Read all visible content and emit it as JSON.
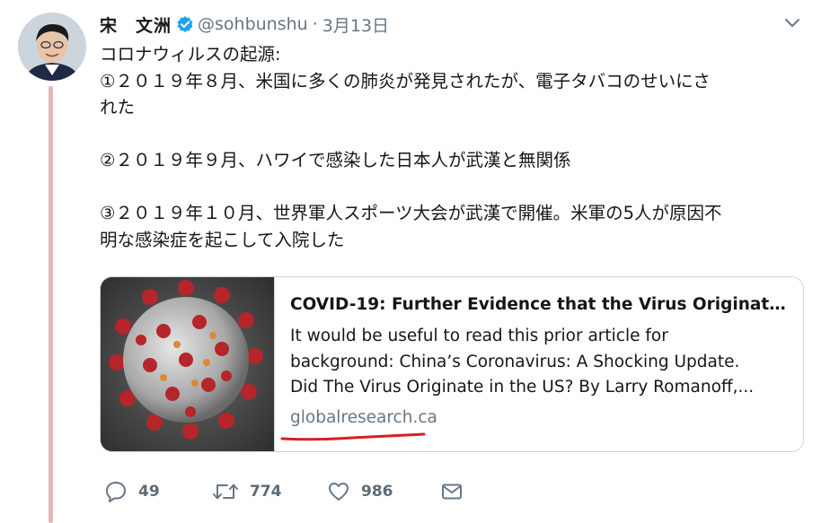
{
  "author": {
    "display_name": "宋　文洲",
    "handle": "@sohbunshu",
    "separator": "·",
    "date": "3月13日"
  },
  "tweet": {
    "lines": [
      "コロナウィルスの起源:",
      "①２０１９年８月、米国に多くの肺炎が発見されたが、電子タバコのせいにさ",
      "れた",
      "",
      "②２０１９年９月、ハワイで感染した日本人が武漢と無関係",
      "",
      "③２０１９年１０月、世界軍人スポーツ大会が武漢で開催。米軍の5人が原因不",
      "明な感染症を起こして入院した"
    ]
  },
  "card": {
    "title": "COVID-19: Further Evidence that the Virus Originat…",
    "description_lines": [
      "It would be useful to read this prior article for",
      "background: China’s Coronavirus: A Shocking Update.",
      "Did The Virus Originate in the US? By Larry Romanoff,..."
    ],
    "domain": "globalresearch.ca"
  },
  "actions": {
    "reply_count": "49",
    "retweet_count": "774",
    "like_count": "986"
  },
  "icons": {
    "verified": "verified-badge-icon",
    "more": "chevron-down-icon",
    "reply": "reply-icon",
    "retweet": "retweet-icon",
    "like": "heart-icon",
    "dm": "envelope-icon"
  },
  "colors": {
    "verified": "#1da1f2",
    "secondary_text": "#657786",
    "card_border": "#ccd6dd",
    "thread_line": "#e8b6bd",
    "annotation_underline": "#d62020"
  }
}
